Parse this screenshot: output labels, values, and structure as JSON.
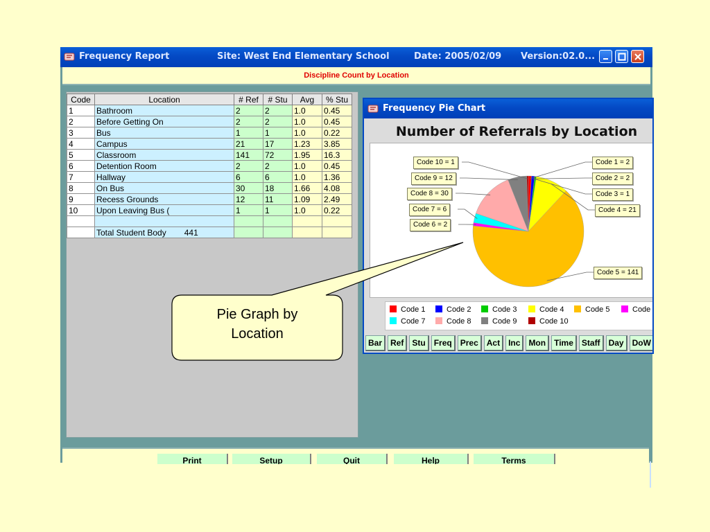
{
  "main_window": {
    "app_title": "Frequency Report",
    "site": "Site: West End Elementary School",
    "date": "Date: 2005/02/09",
    "version": "Version:02.0...",
    "subtitle": "Discipline Count by Location"
  },
  "table": {
    "headers": [
      "Code",
      "Location",
      "# Ref",
      "# Stu",
      "Avg",
      "% Stu"
    ],
    "rows": [
      [
        "1",
        "Bathroom",
        "2",
        "2",
        "1.0",
        "0.45"
      ],
      [
        "2",
        "Before Getting On",
        "2",
        "2",
        "1.0",
        "0.45"
      ],
      [
        "3",
        "Bus",
        "1",
        "1",
        "1.0",
        "0.22"
      ],
      [
        "4",
        "Campus",
        "21",
        "17",
        "1.23",
        "3.85"
      ],
      [
        "5",
        "Classroom",
        "141",
        "72",
        "1.95",
        "16.3"
      ],
      [
        "6",
        "Detention Room",
        "2",
        "2",
        "1.0",
        "0.45"
      ],
      [
        "7",
        "Hallway",
        "6",
        "6",
        "1.0",
        "1.36"
      ],
      [
        "8",
        "On Bus",
        "30",
        "18",
        "1.66",
        "4.08"
      ],
      [
        "9",
        "Recess Grounds",
        "12",
        "11",
        "1.09",
        "2.49"
      ],
      [
        "10",
        "Upon Leaving Bus (",
        "1",
        "1",
        "1.0",
        "0.22"
      ]
    ],
    "total_label": "Total Student Body",
    "total_value": "441"
  },
  "bottom_buttons": [
    "Print",
    "Setup",
    "Quit",
    "Help",
    "Terms"
  ],
  "pie_window": {
    "title": "Frequency Pie Chart",
    "buttons": [
      "Bar",
      "Ref",
      "Stu",
      "Freq",
      "Prec",
      "Act",
      "Inc",
      "Mon",
      "Time",
      "Staff",
      "Day",
      "DoW"
    ]
  },
  "chart_data": {
    "type": "pie",
    "title": "Number of Referrals by Location",
    "categories": [
      "Code 1",
      "Code 2",
      "Code 3",
      "Code 4",
      "Code 5",
      "Code 6",
      "Code 7",
      "Code 8",
      "Code 9",
      "Code 10"
    ],
    "values": [
      2,
      2,
      1,
      21,
      141,
      2,
      6,
      30,
      12,
      1
    ],
    "colors": [
      "#FF0000",
      "#0000FF",
      "#00CC00",
      "#FFFF00",
      "#FFC000",
      "#FF00FF",
      "#00FFFF",
      "#FFAAAA",
      "#808080",
      "#B00000"
    ],
    "callouts": [
      "Code 1  = 2",
      "Code 2  = 2",
      "Code 3  = 1",
      "Code 4  = 21",
      "Code 5  = 141",
      "Code 6  = 2",
      "Code 7  = 6",
      "Code 8  = 30",
      "Code 9  = 12",
      "Code 10  = 1"
    ],
    "legend": [
      "Code 1",
      "Code 2",
      "Code 3",
      "Code 4",
      "Code 5",
      "Code",
      "Code 7",
      "Code 8",
      "Code 9",
      "Code 10"
    ]
  },
  "annotation": {
    "line1": "Pie Graph by",
    "line2": "Location"
  }
}
